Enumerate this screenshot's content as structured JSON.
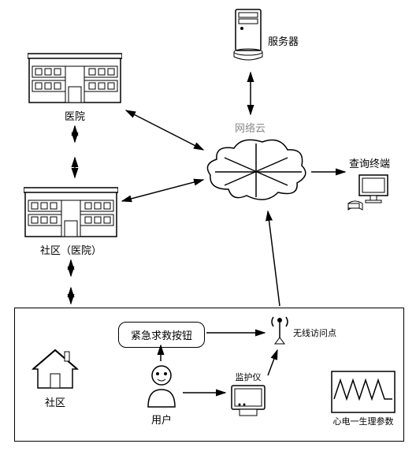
{
  "labels": {
    "server": "服务器",
    "cloud": "网络云",
    "terminal": "查询终端",
    "hospital": "医院",
    "community_hospital": "社区（医院）",
    "community": "社区",
    "user": "用户",
    "emergency_button": "紧急求救按钮",
    "monitor": "监护仪",
    "wireless_ap": "无线访问点",
    "ecg": "心电一生理参数"
  },
  "chart_data": {
    "type": "diagram",
    "title": "",
    "nodes": [
      {
        "id": "server",
        "label": "服务器"
      },
      {
        "id": "cloud",
        "label": "网络云"
      },
      {
        "id": "terminal",
        "label": "查询终端"
      },
      {
        "id": "hospital",
        "label": "医院"
      },
      {
        "id": "community_hospital",
        "label": "社区（医院）"
      },
      {
        "id": "community",
        "label": "社区"
      },
      {
        "id": "user",
        "label": "用户"
      },
      {
        "id": "emergency_button",
        "label": "紧急求救按钮"
      },
      {
        "id": "monitor",
        "label": "监护仪"
      },
      {
        "id": "wireless_ap",
        "label": "无线访问点"
      },
      {
        "id": "ecg",
        "label": "心电一生理参数"
      }
    ],
    "edges": [
      {
        "from": "server",
        "to": "cloud",
        "dir": "both"
      },
      {
        "from": "cloud",
        "to": "terminal",
        "dir": "one"
      },
      {
        "from": "hospital",
        "to": "cloud",
        "dir": "both"
      },
      {
        "from": "community_hospital",
        "to": "cloud",
        "dir": "both"
      },
      {
        "from": "hospital",
        "to": "community_hospital",
        "dir": "both"
      },
      {
        "from": "community_hospital",
        "to": "community_group",
        "dir": "both"
      },
      {
        "from": "user",
        "to": "emergency_button",
        "dir": "one"
      },
      {
        "from": "user",
        "to": "monitor",
        "dir": "one"
      },
      {
        "from": "monitor",
        "to": "wireless_ap",
        "dir": "one"
      },
      {
        "from": "emergency_button",
        "to": "wireless_ap",
        "dir": "one"
      },
      {
        "from": "wireless_ap",
        "to": "cloud",
        "dir": "one"
      }
    ]
  }
}
